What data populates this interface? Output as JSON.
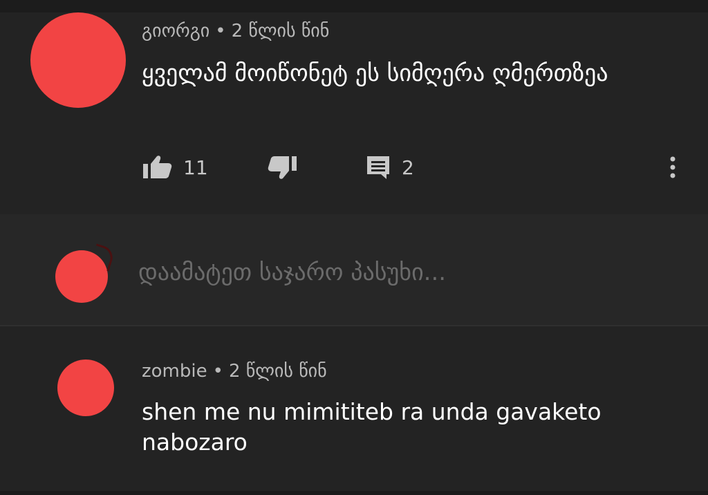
{
  "comments": [
    {
      "author": "გიორგი",
      "separator": "•",
      "time": "2 წლის წინ",
      "text": "ყველამ მოიწონეტ ეს სიმღერა ღმერთზეა",
      "likes": "11",
      "replies": "2"
    },
    {
      "author": "zombie",
      "separator": "•",
      "time": "2 წლის წინ",
      "text": "shen me nu mimititeb ra unda gavaketo nabozaro"
    }
  ],
  "reply_box": {
    "placeholder": "დაამატეთ საჯარო პასუხი..."
  },
  "icons": {
    "like": "thumb-up-icon",
    "dislike": "thumb-down-icon",
    "reply": "comment-icon",
    "more": "more-vert-icon"
  },
  "colors": {
    "background": "#232323",
    "reply_background": "#272727",
    "avatar": "#f24444",
    "meta_text": "#b9b9b9",
    "placeholder_text": "#6b6b6b"
  }
}
